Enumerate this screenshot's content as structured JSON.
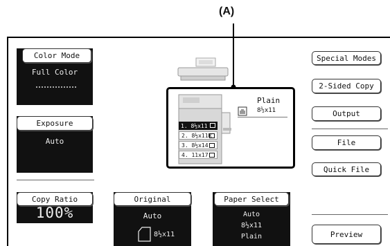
{
  "annotation": {
    "label": "(A)"
  },
  "color_mode": {
    "button": "Color Mode",
    "value": "Full Color"
  },
  "exposure": {
    "button": "Exposure",
    "value": "Auto"
  },
  "copy_ratio": {
    "button": "Copy Ratio",
    "value": "100%"
  },
  "original": {
    "button": "Original",
    "value": "Auto",
    "size": "8½x11"
  },
  "paper_select": {
    "button": "Paper Select",
    "value": "Auto",
    "size": "8½x11",
    "type": "Plain"
  },
  "paper_status": {
    "type": "Plain",
    "size": "8½x11"
  },
  "trays": [
    {
      "label": "1. 8½x11",
      "selected": true
    },
    {
      "label": "2. 8½x11R",
      "selected": false
    },
    {
      "label": "3. 8½x14",
      "selected": false
    },
    {
      "label": "4. 11x17",
      "selected": false
    }
  ],
  "right_buttons": {
    "special_modes": "Special Modes",
    "two_sided_copy": "2-Sided Copy",
    "output": "Output",
    "file": "File",
    "quick_file": "Quick File",
    "preview": "Preview"
  }
}
